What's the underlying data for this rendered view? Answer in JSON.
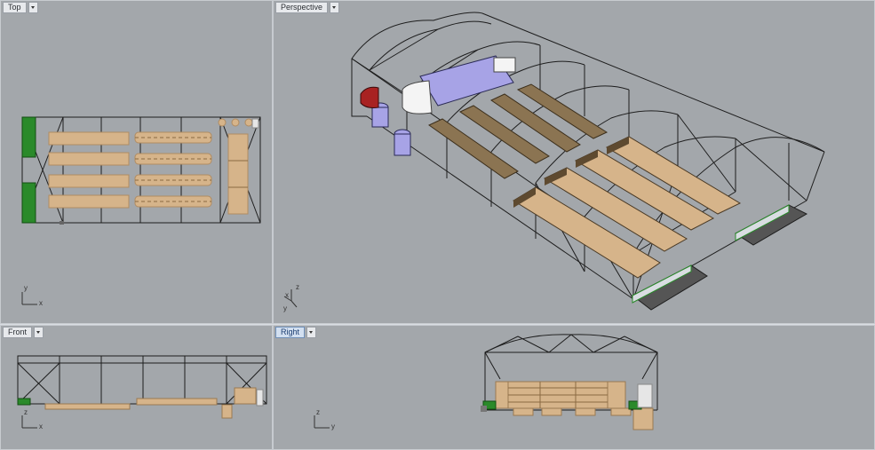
{
  "viewports": {
    "top": {
      "label": "Top"
    },
    "perspective": {
      "label": "Perspective"
    },
    "front": {
      "label": "Front"
    },
    "right": {
      "label": "Right"
    }
  },
  "axes": {
    "top": {
      "v": "y",
      "h": "x"
    },
    "perspective": {
      "up": "z",
      "left": "x",
      "depth": "y"
    },
    "front": {
      "v": "z",
      "h": "x"
    },
    "right": {
      "v": "z",
      "h": "y"
    }
  },
  "colors": {
    "viewport_bg": "#a3a7ab",
    "wood": "#d6b48a",
    "green": "#2a8a2a",
    "lavender": "#a7a3e6",
    "red": "#a82222"
  }
}
